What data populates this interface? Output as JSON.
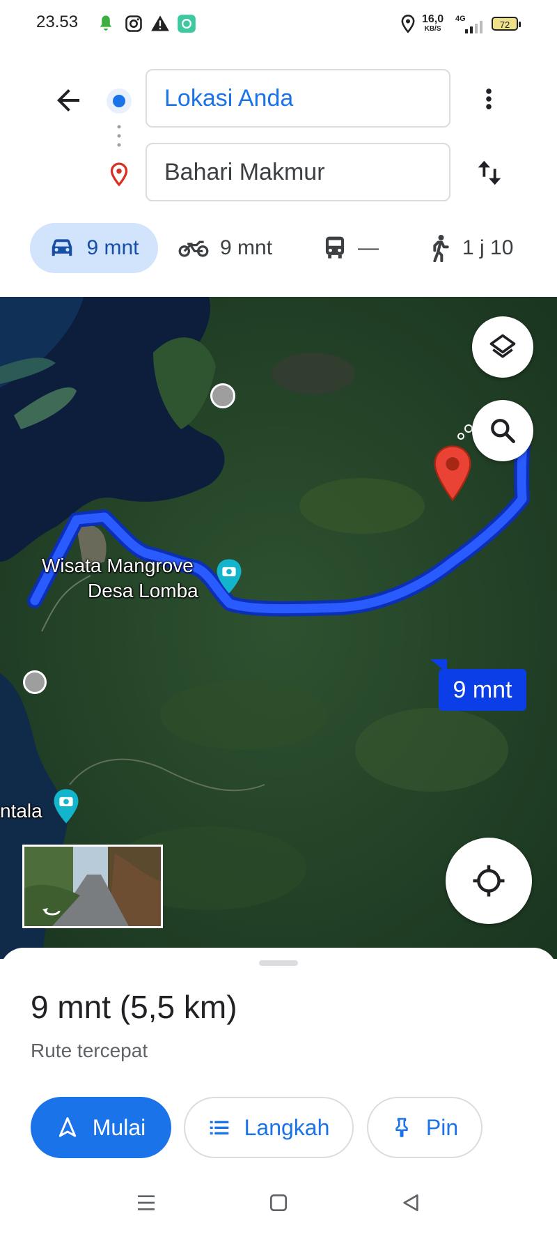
{
  "status_bar": {
    "time": "23.53",
    "speed_value": "16,0",
    "speed_unit": "KB/S",
    "network": "4G",
    "battery": "72",
    "icons": [
      "notification-bell-icon",
      "instagram-icon",
      "warning-icon",
      "app-icon",
      "location-pin-icon",
      "signal-icon",
      "battery-icon"
    ]
  },
  "header": {
    "origin": "Lokasi Anda",
    "destination": "Bahari Makmur"
  },
  "travel_modes": [
    {
      "mode": "car",
      "label": "9 mnt",
      "selected": true
    },
    {
      "mode": "motorcycle",
      "label": "9 mnt"
    },
    {
      "mode": "transit",
      "label": "—"
    },
    {
      "mode": "walk",
      "label": "1 j 10"
    }
  ],
  "map": {
    "place_label_1_line1": "Wisata Mangrove",
    "place_label_1_line2": "Desa Lomba",
    "place_label_2": "ntala",
    "route_time": "9 mnt"
  },
  "summary": {
    "title": "9 mnt (5,5 km)",
    "subtitle": "Rute tercepat"
  },
  "actions": {
    "start": "Mulai",
    "steps": "Langkah",
    "pin": "Pin"
  },
  "colors": {
    "accent": "#1a73e8",
    "route": "#1a47f5",
    "selected_mode_bg": "#d2e3fc",
    "destination_pin": "#d93025"
  }
}
